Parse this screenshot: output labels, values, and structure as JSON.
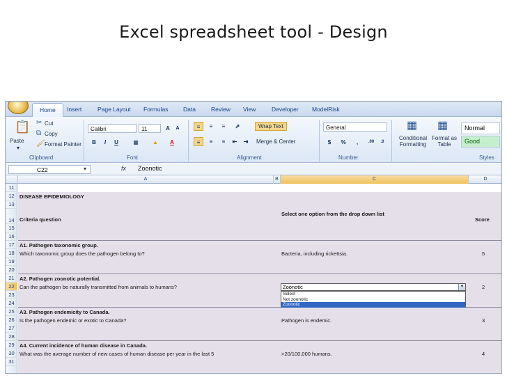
{
  "slide_title": "Excel spreadsheet tool - Design",
  "ribbon_tabs": [
    "Home",
    "Insert",
    "Page Layout",
    "Formulas",
    "Data",
    "Review",
    "View",
    "Developer",
    "ModelRisk"
  ],
  "ribbon": {
    "paste": "Paste",
    "cut": "Cut",
    "copy": "Copy",
    "format_painter": "Format Painter",
    "clipboard": "Clipboard",
    "font_name": "Calibri",
    "font_size": "11",
    "font_group": "Font",
    "wrap_text": "Wrap Text",
    "merge_center": "Merge & Center",
    "alignment_group": "Alignment",
    "number_format": "General",
    "number_group": "Number",
    "conditional_formatting": "Conditional Formatting",
    "format_as_table": "Format as Table",
    "style_normal": "Normal",
    "style_good": "Good",
    "styles_group": "Styles"
  },
  "formula_bar": {
    "name_box": "C22",
    "fx": "fx",
    "value": "Zoonotic"
  },
  "columns": [
    "A",
    "B",
    "C",
    "D"
  ],
  "rows": [
    "11",
    "12",
    "13",
    "14",
    "15",
    "16",
    "17",
    "18",
    "19",
    "20",
    "21",
    "22",
    "23",
    "24",
    "25",
    "26",
    "27",
    "28",
    "29",
    "30",
    "31"
  ],
  "sheet": {
    "r12": "DISEASE EPIDEMIOLOGY",
    "r14_a": "Criteria question",
    "r14_c": "Select one option from the drop down list",
    "r14_d": "Score",
    "r17_a": "A1. Pathogen taxonomic group.",
    "r18_a": "Which taxonomic group does the pathogen belong to?",
    "r18_c": "Bacteria, including rickettsia.",
    "r18_d": "5",
    "r21_a": "A2. Pathogen zoonotic potential.",
    "r22_a": "Can the pathogen be naturally transmitted from animals to humans?",
    "r22_c": "Zoonotic",
    "r22_d": "2",
    "dropdown_options": [
      "Select",
      "Not zoonotic",
      "Zoonotic"
    ],
    "r25_a": "A3. Pathogen endemicity to Canada.",
    "r26_a": "Is the pathogen endemic or exotic to Canada?",
    "r26_c": "Pathogen is endemic.",
    "r26_d": "3",
    "r29_a": "A4. Current incidence of human disease in Canada.",
    "r30_a": "What was the average number of new cases of human disease per year in the last 5",
    "r30_c": ">20/100,000 humans.",
    "r30_d": "4"
  }
}
